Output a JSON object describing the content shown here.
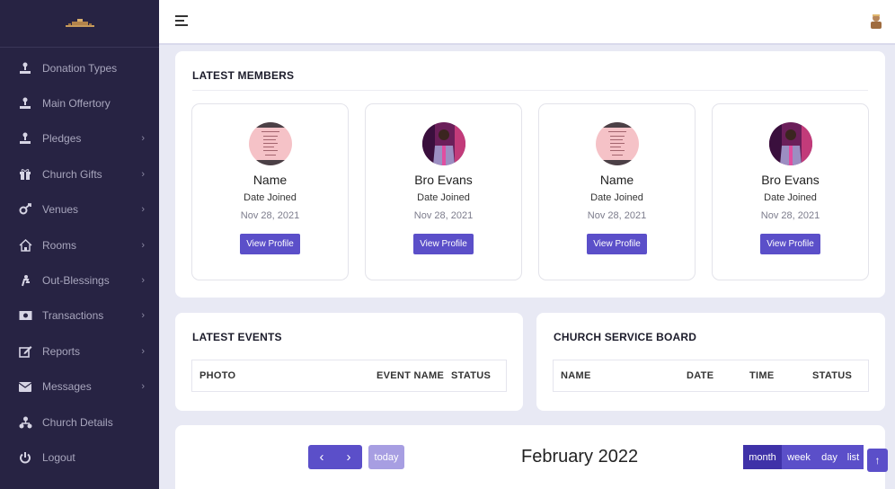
{
  "sidebar": {
    "items": [
      {
        "label": "Donation Types",
        "icon": "hand-donate-icon",
        "has_submenu": false
      },
      {
        "label": "Main Offertory",
        "icon": "hand-offer-icon",
        "has_submenu": false
      },
      {
        "label": "Pledges",
        "icon": "hand-pledge-icon",
        "has_submenu": true
      },
      {
        "label": "Church Gifts",
        "icon": "gift-icon",
        "has_submenu": true
      },
      {
        "label": "Venues",
        "icon": "venue-icon",
        "has_submenu": true
      },
      {
        "label": "Rooms",
        "icon": "home-icon",
        "has_submenu": true
      },
      {
        "label": "Out-Blessings",
        "icon": "blessing-icon",
        "has_submenu": true
      },
      {
        "label": "Transactions",
        "icon": "money-icon",
        "has_submenu": true
      },
      {
        "label": "Reports",
        "icon": "edit-icon",
        "has_submenu": true
      },
      {
        "label": "Messages",
        "icon": "envelope-icon",
        "has_submenu": true
      },
      {
        "label": "Church Details",
        "icon": "sitemap-icon",
        "has_submenu": false
      },
      {
        "label": "Logout",
        "icon": "power-icon",
        "has_submenu": false
      }
    ]
  },
  "members": {
    "title": "LATEST MEMBERS",
    "list": [
      {
        "name": "Name",
        "joined_label": "Date Joined",
        "date": "Nov 28, 2021",
        "button": "View Profile",
        "photo": "document-photo"
      },
      {
        "name": "Bro Evans",
        "joined_label": "Date Joined",
        "date": "Nov 28, 2021",
        "button": "View Profile",
        "photo": "person-photo"
      },
      {
        "name": "Name",
        "joined_label": "Date Joined",
        "date": "Nov 28, 2021",
        "button": "View Profile",
        "photo": "document-photo"
      },
      {
        "name": "Bro Evans",
        "joined_label": "Date Joined",
        "date": "Nov 28, 2021",
        "button": "View Profile",
        "photo": "person-photo"
      }
    ]
  },
  "events": {
    "title": "LATEST EVENTS",
    "columns": [
      "PHOTO",
      "EVENT NAME",
      "STATUS"
    ]
  },
  "service": {
    "title": "CHURCH SERVICE BOARD",
    "columns": [
      "NAME",
      "DATE",
      "TIME",
      "STATUS"
    ]
  },
  "calendar": {
    "prev": "‹",
    "next": "›",
    "today": "today",
    "month": "February 2022",
    "views": [
      "month",
      "week",
      "day",
      "list"
    ],
    "active_view": "month"
  },
  "scroll_top": "↑",
  "colors": {
    "sidebar": "#272343",
    "accent": "#5b4fc9",
    "accent_dark": "#3f32a8",
    "background": "#e8e9f4"
  }
}
